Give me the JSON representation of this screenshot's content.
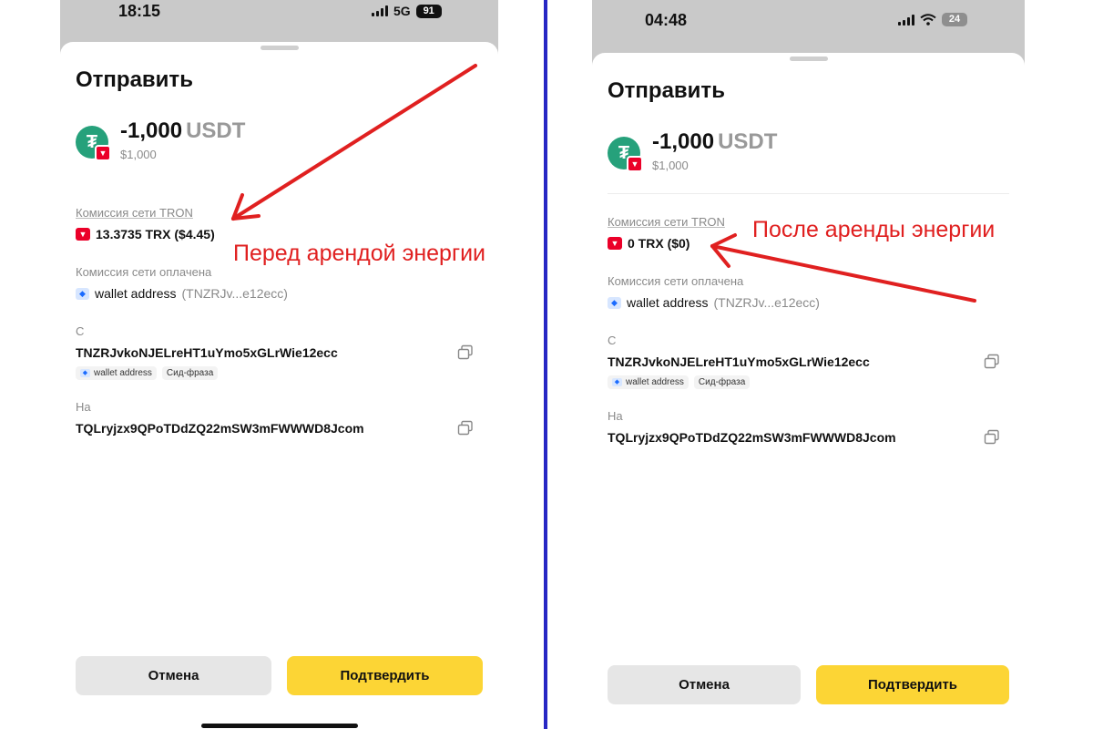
{
  "colors": {
    "accent_yellow": "#fcd535",
    "tron_red": "#eb0029",
    "annotation_red": "#e02020",
    "divider_blue": "#2727c4"
  },
  "left": {
    "status": {
      "time": "18:15",
      "network": "5G",
      "battery": "91"
    },
    "title": "Отправить",
    "amount": {
      "value": "-1,000",
      "currency": "USDT",
      "usd": "$1,000"
    },
    "fee": {
      "label": "Комиссия сети TRON",
      "value": "13.3735 TRX ($4.45)"
    },
    "fee_paid": {
      "label": "Комиссия сети оплачена",
      "wallet": "wallet address",
      "short": "(TNZRJv...e12ecc)"
    },
    "from": {
      "label": "С",
      "address": "TNZRJvkoNJELreHT1uYmo5xGLrWie12ecc",
      "tag_wallet": "wallet address",
      "tag_seed": "Сид-фраза"
    },
    "to": {
      "label": "На",
      "address": "TQLryjzx9QPoTDdZQ22mSW3mFWWWD8Jcom"
    },
    "buttons": {
      "cancel": "Отмена",
      "confirm": "Подтвердить"
    },
    "annotation": "Перед арендой энергии"
  },
  "right": {
    "status": {
      "time": "04:48",
      "battery": "24"
    },
    "title": "Отправить",
    "amount": {
      "value": "-1,000",
      "currency": "USDT",
      "usd": "$1,000"
    },
    "fee": {
      "label": "Комиссия сети TRON",
      "value": "0 TRX ($0)"
    },
    "fee_paid": {
      "label": "Комиссия сети оплачена",
      "wallet": "wallet address",
      "short": "(TNZRJv...e12ecc)"
    },
    "from": {
      "label": "С",
      "address": "TNZRJvkoNJELreHT1uYmo5xGLrWie12ecc",
      "tag_wallet": "wallet address",
      "tag_seed": "Сид-фраза"
    },
    "to": {
      "label": "На",
      "address": "TQLryjzx9QPoTDdZQ22mSW3mFWWWD8Jcom"
    },
    "buttons": {
      "cancel": "Отмена",
      "confirm": "Подтвердить"
    },
    "annotation": "После аренды энергии"
  },
  "icons": {
    "coin": "tether-icon",
    "chain_badge": "tron-icon",
    "wallet": "wallet-icon",
    "copy": "copy-icon"
  }
}
